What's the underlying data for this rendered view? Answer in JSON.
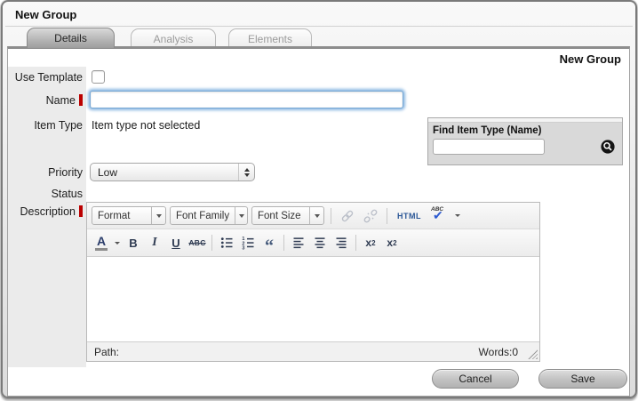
{
  "window": {
    "title": "New Group"
  },
  "tabs": {
    "details": "Details",
    "analysis": "Analysis",
    "elements": "Elements"
  },
  "content": {
    "page_title": "New Group"
  },
  "form": {
    "use_template_label": "Use Template",
    "name_label": "Name",
    "name_value": "",
    "item_type_label": "Item Type",
    "item_type_value": "Item type not selected",
    "priority_label": "Priority",
    "priority_value": "Low",
    "status_label": "Status",
    "description_label": "Description"
  },
  "find_panel": {
    "title": "Find Item Type (Name)",
    "search_value": "",
    "search_icon": "magnifier-icon"
  },
  "editor": {
    "toolbar": {
      "format": "Format",
      "font_family": "Font Family",
      "font_size": "Font Size",
      "html": "HTML",
      "spellcheck_text": "ABC",
      "forecolor_letter": "A",
      "bold": "B",
      "italic": "I",
      "underline": "U",
      "strikethrough": "ABC",
      "blockquote_glyph": "“",
      "sub_base": "x",
      "sub_exp": "2",
      "sup_base": "x",
      "sup_exp": "2"
    },
    "statusbar": {
      "path": "Path:",
      "words": "Words:0"
    }
  },
  "actions": {
    "cancel": "Cancel",
    "save": "Save"
  },
  "colors": {
    "required_marker": "#bb0000",
    "focus_ring": "#8cb8e2",
    "html_blue": "#2b5797",
    "check_blue": "#2d5bd1",
    "active_tab_gray": "#a8a8a8"
  }
}
